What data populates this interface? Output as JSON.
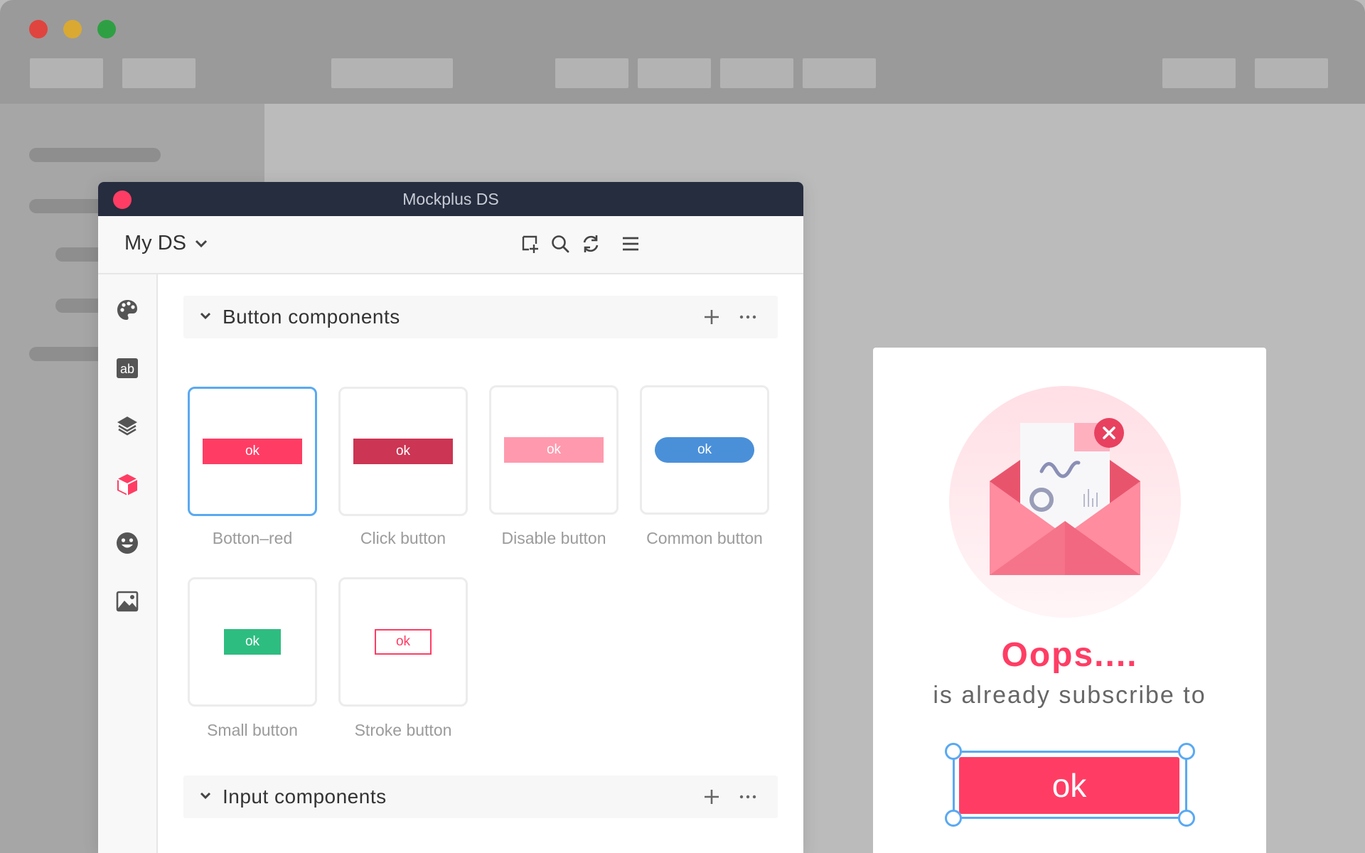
{
  "window": {
    "title": "Mockplus DS"
  },
  "toolbar": {
    "library_name": "My DS",
    "icons": [
      "add-component-icon",
      "search-icon",
      "refresh-icon",
      "menu-icon"
    ]
  },
  "leftbar": {
    "icons": [
      "palette-icon",
      "text-style-icon",
      "layers-icon",
      "component-icon",
      "emoji-icon",
      "image-icon"
    ],
    "active_color": "#ff3d64"
  },
  "sections": {
    "buttons": {
      "title": "Button components",
      "cards": [
        {
          "label": "Botton–red",
          "button_text": "ok"
        },
        {
          "label": "Click button",
          "button_text": "ok"
        },
        {
          "label": "Disable button",
          "button_text": "ok"
        },
        {
          "label": "Common button",
          "button_text": "ok"
        },
        {
          "label": "Small button",
          "button_text": "ok"
        },
        {
          "label": "Stroke button",
          "button_text": "ok"
        }
      ]
    },
    "inputs": {
      "title": "Input components"
    }
  },
  "dialog": {
    "title": "Oops....",
    "subtitle": "is already subscribe to",
    "button_label": "ok"
  },
  "colors": {
    "brand": "#ff3d64",
    "selection": "#5aa9f2",
    "titlebar": "#262d3e",
    "click": "#cc3553",
    "disable": "#ff9aae",
    "common": "#4a90d9",
    "small": "#2ebd80"
  }
}
